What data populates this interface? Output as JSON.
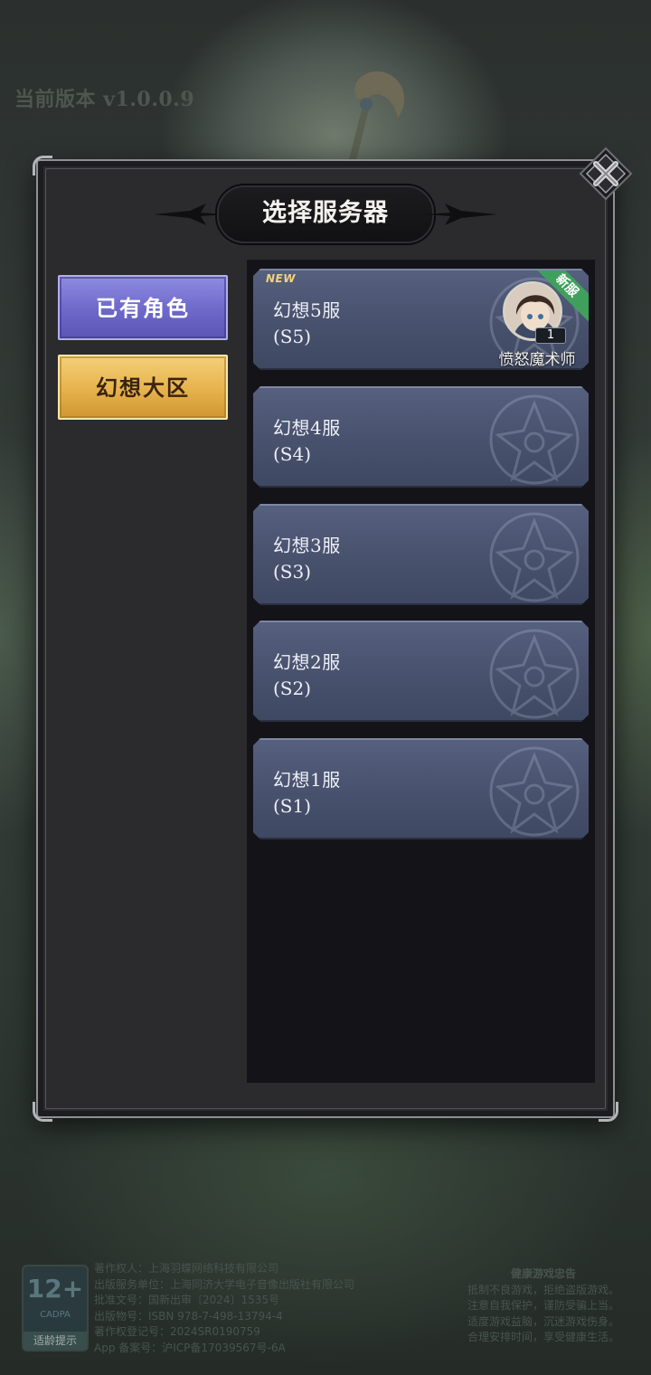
{
  "version_label": "当前版本 v1.0.0.9",
  "dialog": {
    "title": "选择服务器"
  },
  "tabs": [
    {
      "label": "已有角色",
      "state": "selected"
    },
    {
      "label": "幻想大区",
      "state": "normal"
    }
  ],
  "servers": [
    {
      "name": "幻想5服",
      "code": "(S5)",
      "badge": "NEW",
      "ribbon": "新服",
      "character": {
        "name": "愤怒魔术师",
        "level": "1"
      }
    },
    {
      "name": "幻想4服",
      "code": "(S4)"
    },
    {
      "name": "幻想3服",
      "code": "(S3)"
    },
    {
      "name": "幻想2服",
      "code": "(S2)"
    },
    {
      "name": "幻想1服",
      "code": "(S1)"
    }
  ],
  "footer": {
    "age_rating": {
      "number": "12+",
      "org": "CADPA",
      "caption": "适龄提示"
    },
    "legal_lines": [
      "著作权人：上海羽蝶网络科技有限公司",
      "出版服务单位：上海同济大学电子音像出版社有限公司",
      "批准文号：国新出审〔2024〕1535号",
      "出版物号：ISBN 978-7-498-13794-4",
      "著作权登记号：2024SR0190759",
      "App 备案号：沪ICP备17039567号-6A"
    ],
    "health_notice": {
      "title": "健康游戏忠告",
      "lines": [
        "抵制不良游戏，拒绝盗版游戏。",
        "注意自我保护，谨防受骗上当。",
        "适度游戏益脑，沉迷游戏伤身。",
        "合理安排时间，享受健康生活。"
      ]
    }
  },
  "colors": {
    "tab_selected": "#6d68c9",
    "tab_normal": "#e6b24c",
    "card": "#4a536f",
    "ribbon": "#3fa05e",
    "new_badge": "#f3d37a"
  },
  "icons": {
    "close": "close-x-icon",
    "title_ornament": "ornament-wing-icon",
    "card_watermark": "flower-emblem-icon"
  }
}
